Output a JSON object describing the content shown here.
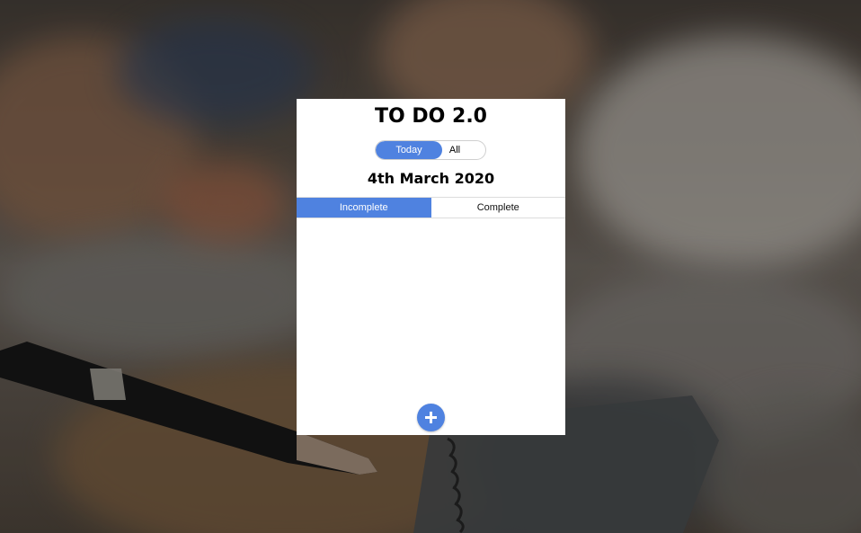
{
  "app": {
    "title": "TO DO 2.0"
  },
  "view_toggle": {
    "options": [
      "Today",
      "All"
    ],
    "selected": "Today"
  },
  "date_heading": "4th March 2020",
  "status_tabs": {
    "items": [
      "Incomplete",
      "Complete"
    ],
    "selected": "Incomplete"
  },
  "tasks": [],
  "add_button": {
    "icon": "plus-icon"
  },
  "colors": {
    "accent": "#4f82e0",
    "card_background": "#ffffff"
  }
}
